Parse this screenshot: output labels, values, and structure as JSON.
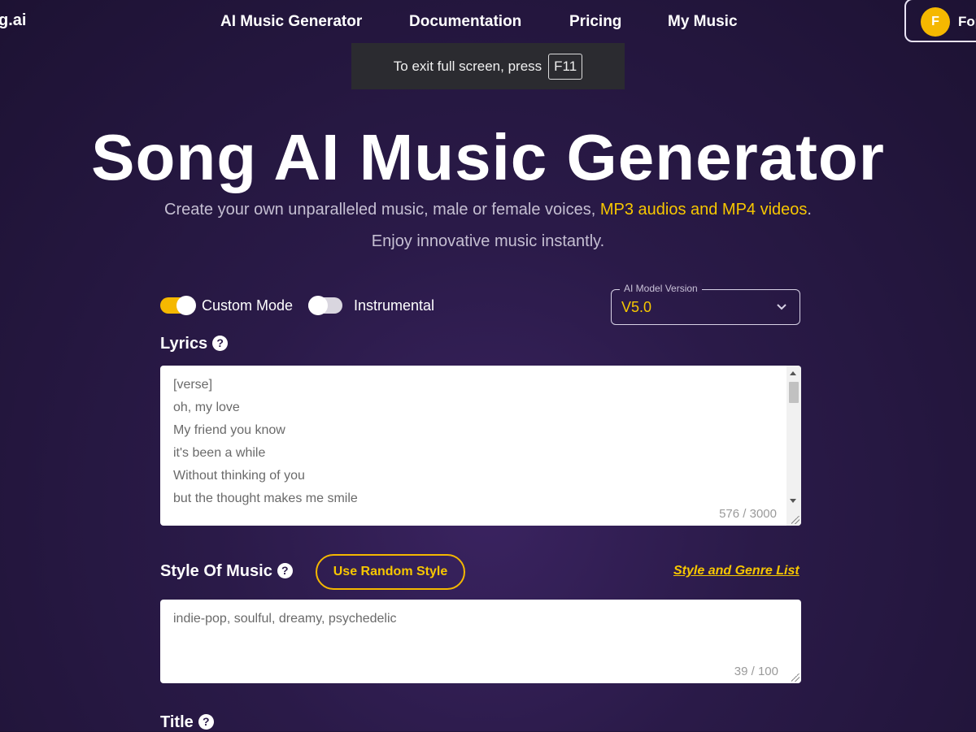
{
  "nav": {
    "logo": "g.ai",
    "links": [
      "AI Music Generator",
      "Documentation",
      "Pricing",
      "My Music"
    ],
    "user_initial": "F",
    "user_name": "Fop"
  },
  "fullscreen_toast": {
    "text": "To exit full screen, press",
    "key": "F11"
  },
  "hero": {
    "title": "Song AI Music Generator",
    "subtitle_prefix": "Create your own unparalleled music, male or female voices, ",
    "subtitle_highlight": "MP3 audios and MP4 videos",
    "subtitle_suffix": ".",
    "subtitle_line2": "Enjoy innovative music instantly."
  },
  "options": {
    "custom_mode_label": "Custom Mode",
    "custom_mode_on": true,
    "instrumental_label": "Instrumental",
    "instrumental_on": false,
    "model_legend": "AI Model Version",
    "model_value": "V5.0"
  },
  "lyrics": {
    "label": "Lyrics",
    "text": "[verse]\noh, my love\nMy friend you know\nit's been a while\nWithout thinking of you\nbut the thought makes me smile",
    "count": "576 / 3000"
  },
  "style": {
    "label": "Style Of Music",
    "random_button": "Use Random Style",
    "genre_link": "Style and Genre List",
    "value": "indie-pop, soulful, dreamy, psychedelic",
    "count": "39 / 100"
  },
  "title_section": {
    "label": "Title"
  },
  "colors": {
    "accent": "#f5b800",
    "background": "#2a1a48"
  }
}
